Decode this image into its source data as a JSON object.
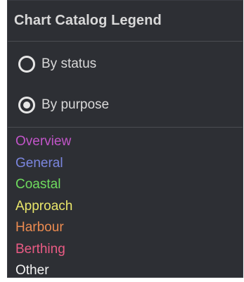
{
  "panel": {
    "title": "Chart Catalog Legend",
    "radios": [
      {
        "label": "By status",
        "selected": false
      },
      {
        "label": "By purpose",
        "selected": true
      }
    ],
    "legend": [
      {
        "label": "Overview",
        "color": "#c255c9"
      },
      {
        "label": "General",
        "color": "#7b86df"
      },
      {
        "label": "Coastal",
        "color": "#6fdc5e"
      },
      {
        "label": "Approach",
        "color": "#e9e66a"
      },
      {
        "label": "Harbour",
        "color": "#ec8b50"
      },
      {
        "label": "Berthing",
        "color": "#ea5b84"
      },
      {
        "label": "Other",
        "color": "#f2f2f2"
      }
    ]
  }
}
